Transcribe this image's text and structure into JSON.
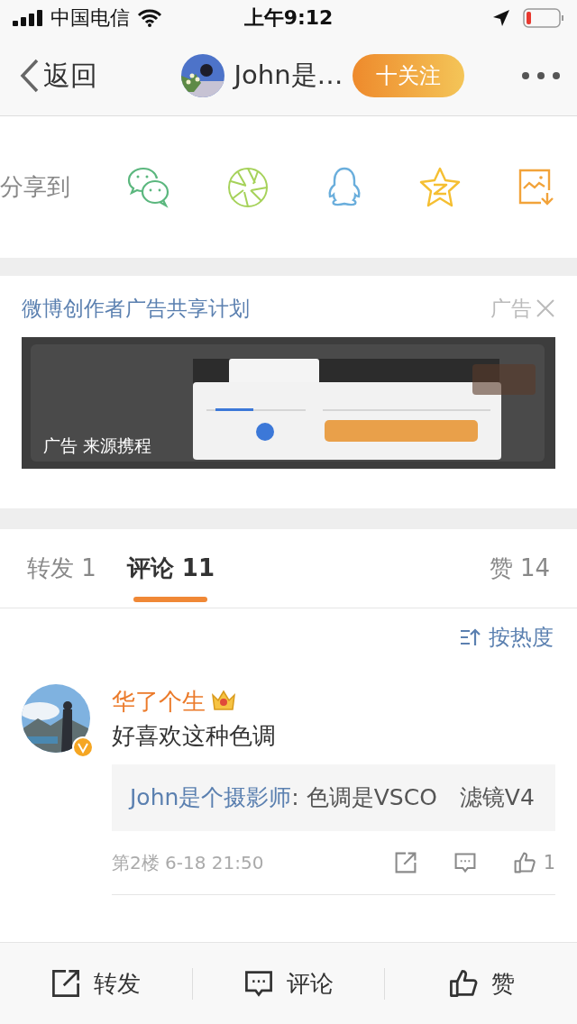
{
  "status_bar": {
    "carrier": "中国电信",
    "time": "上午9:12"
  },
  "nav": {
    "back": "返回",
    "title": "John是…",
    "follow": "十关注"
  },
  "share": {
    "label": "分享到",
    "targets": [
      {
        "kind": "chat"
      },
      {
        "kind": "aperture"
      },
      {
        "kind": "penguin"
      },
      {
        "kind": "star"
      },
      {
        "kind": "save-image"
      }
    ]
  },
  "ad": {
    "title": "微博创作者广告共享计划",
    "tag": "广告",
    "caption": "广告 来源携程"
  },
  "tabs": [
    {
      "label": "转发 1",
      "selected": false
    },
    {
      "label": "评论 11",
      "selected": true
    },
    {
      "label": "赞 14",
      "selected": false
    }
  ],
  "sort": "按热度",
  "comments": [
    {
      "user": "华了个生",
      "verified": true,
      "vip": true,
      "text": "好喜欢这种色调",
      "reply": {
        "author": "John是个摄影师",
        "text": ": 色调是VSCO　滤镜V4"
      },
      "meta": "第2楼 6-18 21:50",
      "likes": "1"
    }
  ],
  "actions": [
    {
      "kind": "repost",
      "label": "转发"
    },
    {
      "kind": "comment",
      "label": "评论"
    },
    {
      "kind": "like",
      "label": "赞"
    }
  ]
}
